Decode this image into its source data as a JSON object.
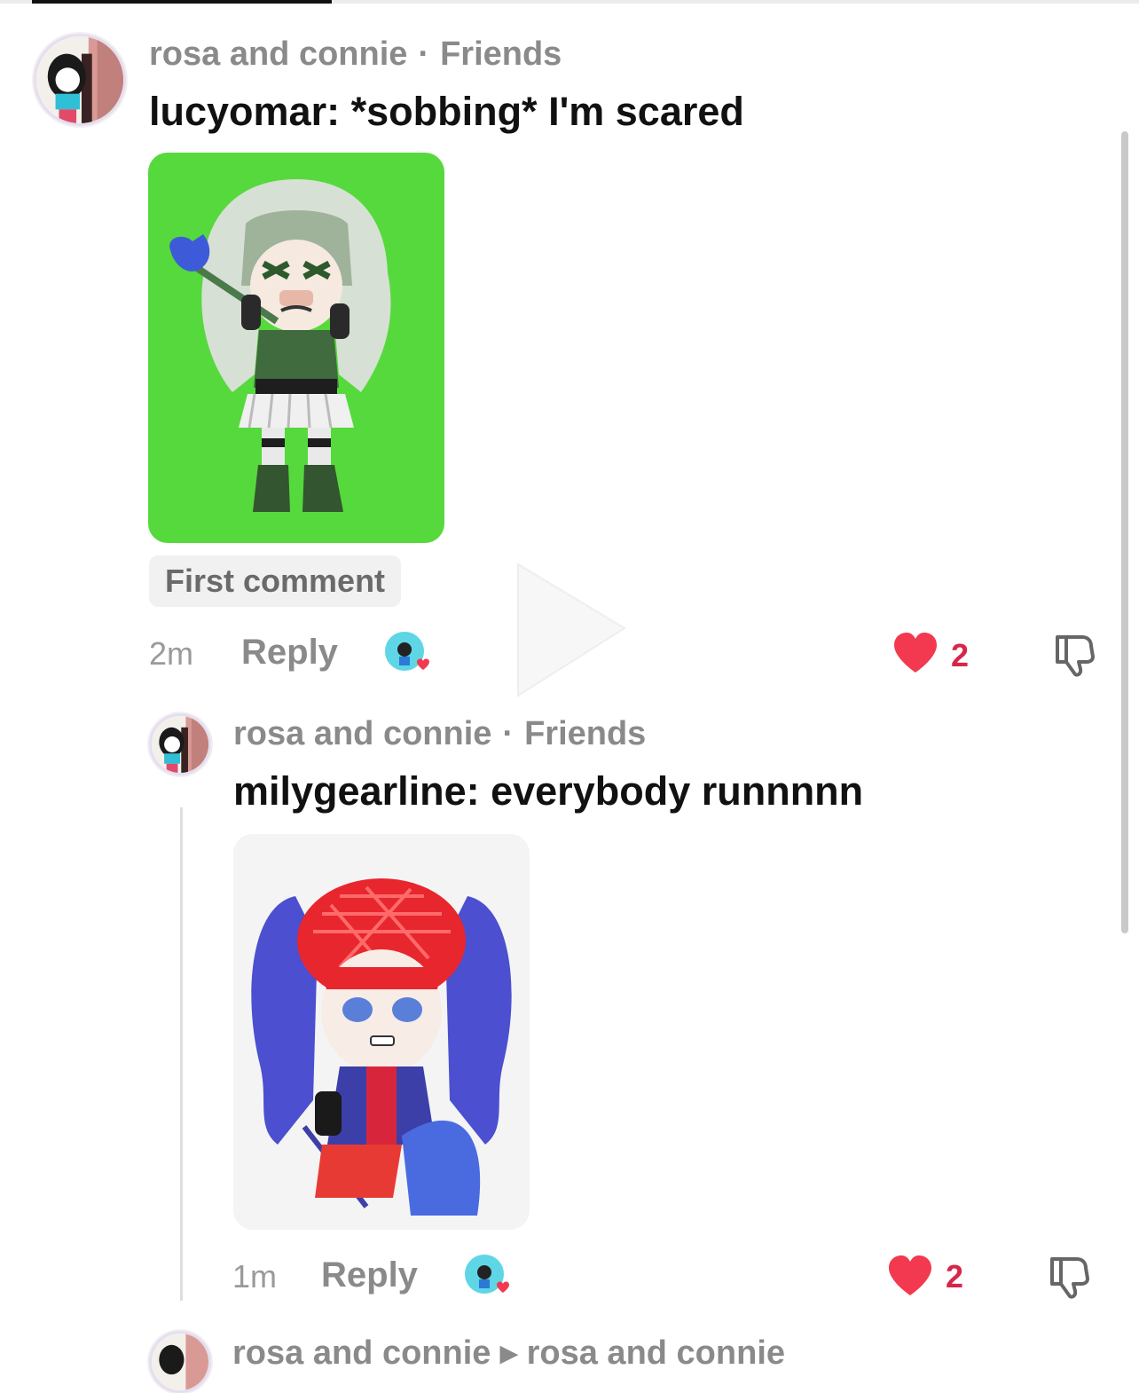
{
  "comments": [
    {
      "author": "rosa and connie",
      "relation": "Friends",
      "separator": "·",
      "text": "lucyomar: *sobbing* I'm scared",
      "chip": "First comment",
      "time": "2m",
      "reply_label": "Reply",
      "likes": "2"
    },
    {
      "author": "rosa and connie",
      "relation": "Friends",
      "separator": "·",
      "text": "milygearline: everybody runnnnn",
      "time": "1m",
      "reply_label": "Reply",
      "likes": "2"
    }
  ],
  "partial_comment": {
    "author": "rosa and connie",
    "arrow": "▸",
    "reply_to": "rosa and connie"
  },
  "colors": {
    "green_screen": "#56d93d",
    "like_red": "#f2394f",
    "meta_gray": "#8a8a8a"
  },
  "icons": [
    "avatar",
    "creator-liked-icon",
    "heart-icon",
    "thumbs-down-icon",
    "play-icon"
  ]
}
